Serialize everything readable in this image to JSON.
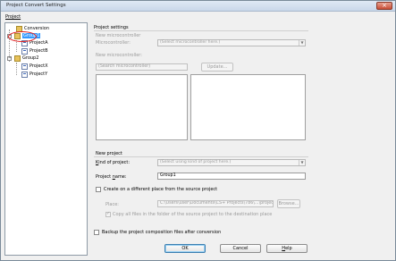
{
  "window": {
    "title": "Project Convert Settings",
    "close_label": "×"
  },
  "menu": {
    "project": "Project"
  },
  "tree": {
    "root": "Conversion",
    "group1": "Group1",
    "group1_items": [
      "ProjectA",
      "ProjectB"
    ],
    "group2": "Group2",
    "group2_items": [
      "ProjectX",
      "ProjectY"
    ]
  },
  "settings": {
    "section_title": "Project settings",
    "new_micro": {
      "title": "New microcontroller",
      "microcontroller_label": "Microcontroller:",
      "microcontroller_value": "(Select microcontroller here.)",
      "new_micro_label": "New microcontroller:",
      "search_placeholder": "(Search microcontroller)",
      "update_button": "Update..."
    },
    "new_project": {
      "title": "New project",
      "kind_label": "Kind of project:",
      "kind_value": "(Select using kind of project here.)",
      "name_label": "Project name:",
      "name_value": "Group1",
      "create_diff_label": "Create on a different place from the source project",
      "place_label": "Place:",
      "place_value": "C:\\Users\\user\\Documents\\CS+ Projects\\786\\...\\project\\",
      "browse_button": "Browse...",
      "copy_all_label": "Copy all files in the folder of the source project to the destination place"
    },
    "backup_label": "Backup the project composition files after conversion"
  },
  "footer": {
    "ok": "OK",
    "cancel": "Cancel",
    "help": "Help"
  }
}
